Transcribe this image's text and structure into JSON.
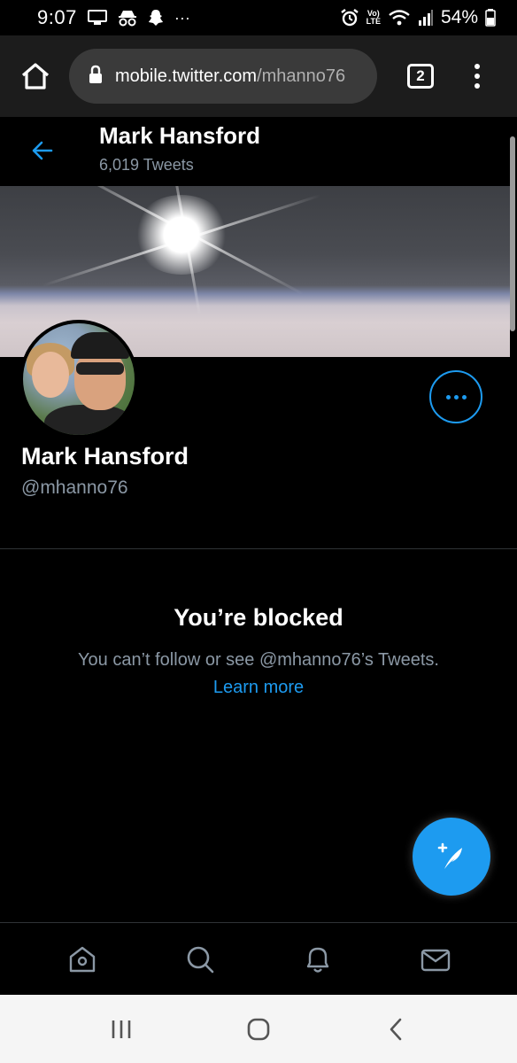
{
  "status_bar": {
    "time": "9:07",
    "battery": "54%",
    "volte_top": "Vo)",
    "volte_bottom": "LTE",
    "more": "···"
  },
  "browser": {
    "url_host": "mobile.twitter.com",
    "url_path": "/mhanno76",
    "tab_count": "2"
  },
  "header": {
    "name": "Mark Hansford",
    "tweet_count": "6,019 Tweets"
  },
  "profile": {
    "name": "Mark Hansford",
    "handle": "@mhanno76"
  },
  "blocked": {
    "title": "You’re blocked",
    "description": "You can’t follow or see @mhanno76’s Tweets.",
    "learn_more": "Learn more"
  },
  "colors": {
    "accent": "#1d9bf0",
    "background": "#000000",
    "secondary_text": "#8b98a5"
  },
  "icons": {
    "bottom_nav": [
      "home-icon",
      "search-icon",
      "notifications-icon",
      "messages-icon"
    ],
    "android_nav": [
      "recents-icon",
      "home-circle-icon",
      "back-icon"
    ]
  }
}
